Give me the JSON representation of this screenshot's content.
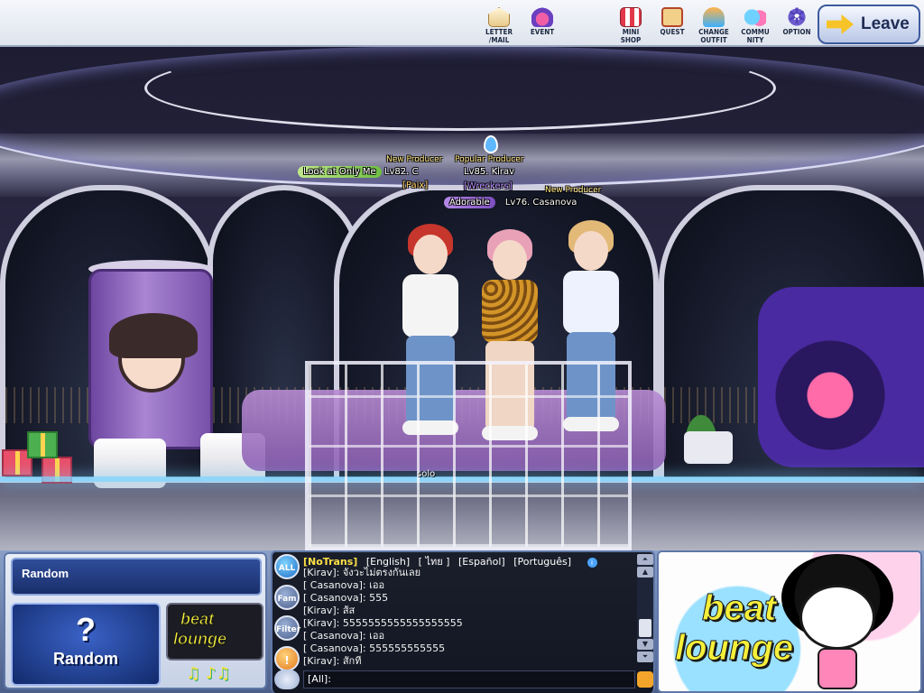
{
  "toolbar": {
    "items": [
      {
        "label_line1": "LETTER",
        "label_line2": "/MAIL",
        "icon": "letter-mail-icon"
      },
      {
        "label_line1": "EVENT",
        "label_line2": "",
        "icon": "event-mask-icon"
      },
      {
        "label_line1": "MINI",
        "label_line2": "SHOP",
        "icon": "mini-shop-icon"
      },
      {
        "label_line1": "QUEST",
        "label_line2": "",
        "icon": "quest-scroll-icon"
      },
      {
        "label_line1": "CHANGE",
        "label_line2": "OUTFIT",
        "icon": "change-outfit-icon"
      },
      {
        "label_line1": "COMMU",
        "label_line2": "NITY",
        "icon": "community-icon"
      },
      {
        "label_line1": "OPTION",
        "label_line2": "",
        "icon": "gear-icon"
      }
    ],
    "leave_label": "Leave"
  },
  "scene": {
    "players": [
      {
        "title": "New Producer",
        "level_name": "Lv82. C",
        "badge": "Look at Only Me",
        "guild": "[Paix]"
      },
      {
        "title": "Popular Producer",
        "level_name": "Lv85. Kirav",
        "badge": "",
        "guild": "[Wreckers]"
      },
      {
        "title": "New Producer",
        "level_name": "Lv76. Casanova",
        "badge": "Adorable",
        "guild": ""
      }
    ],
    "solo_tag": "solo"
  },
  "song": {
    "title": "Random",
    "random_label": "Random",
    "random_symbol": "?",
    "logo_line1": "beat",
    "logo_line2": "lounge",
    "notes": "♫ ♪♫"
  },
  "chat": {
    "tabs": [
      "ALL",
      "Fam",
      "Filter",
      "!"
    ],
    "languages": [
      {
        "label": "[NoTrans]",
        "active": true
      },
      {
        "label": "[English]",
        "active": false
      },
      {
        "label": "[ ไทย ]",
        "active": false
      },
      {
        "label": "[Español]",
        "active": false
      },
      {
        "label": "[Português]",
        "active": false
      }
    ],
    "info_icon": "i",
    "lines": [
      "[Kirav]: จังวะไม่ตรงกันเลย",
      "[ Casanova]: เออ",
      "[ Casanova]: 555",
      "[Kirav]: ส้ส",
      "[Kirav]: 5555555555555555555",
      "[ Casanova]: เออ",
      "[ Casanova]: 555555555555",
      "[Kirav]: สักที"
    ],
    "input_value": "[All]:"
  },
  "banner": {
    "logo_line1": "beat",
    "logo_line2": "lounge"
  },
  "colors": {
    "accent_yellow": "#f5ef3a",
    "panel_blue": "#1a2f6b",
    "lang_active": "#ffe046"
  }
}
